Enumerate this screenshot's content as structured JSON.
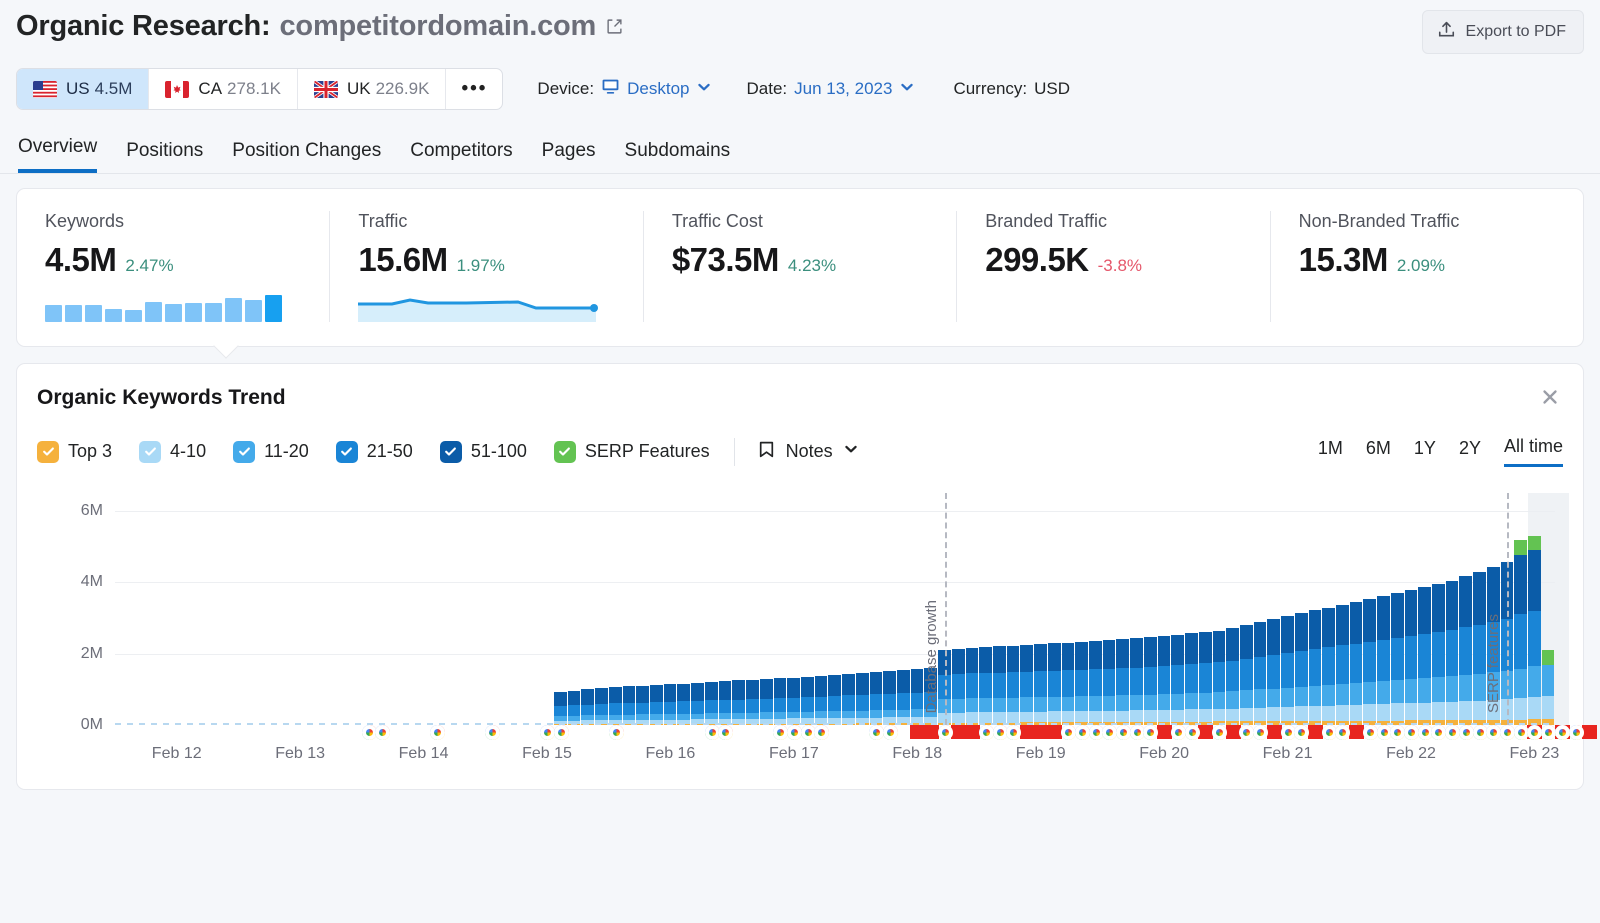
{
  "header": {
    "title_prefix": "Organic Research:",
    "domain": "competitordomain.com",
    "external_link_icon": "external-link-icon",
    "export_label": "Export to PDF",
    "export_icon": "upload-icon"
  },
  "filters": {
    "countries": [
      {
        "code": "US",
        "value": "4.5M",
        "flag": "us-flag-icon",
        "active": true
      },
      {
        "code": "CA",
        "value": "278.1K",
        "flag": "ca-flag-icon",
        "active": false
      },
      {
        "code": "UK",
        "value": "226.9K",
        "flag": "uk-flag-icon",
        "active": false
      }
    ],
    "more_label": "•••",
    "device": {
      "label": "Device:",
      "value": "Desktop",
      "icon": "monitor-icon"
    },
    "date": {
      "label": "Date:",
      "value": "Jun 13, 2023"
    },
    "currency": {
      "label": "Currency:",
      "value": "USD"
    }
  },
  "tabs": [
    {
      "label": "Overview",
      "active": true
    },
    {
      "label": "Positions",
      "active": false
    },
    {
      "label": "Position Changes",
      "active": false
    },
    {
      "label": "Competitors",
      "active": false
    },
    {
      "label": "Pages",
      "active": false
    },
    {
      "label": "Subdomains",
      "active": false
    }
  ],
  "metrics": [
    {
      "label": "Keywords",
      "value": "4.5M",
      "delta": "2.47%",
      "delta_dir": "pos",
      "spark": "bars"
    },
    {
      "label": "Traffic",
      "value": "15.6M",
      "delta": "1.97%",
      "delta_dir": "pos",
      "spark": "area"
    },
    {
      "label": "Traffic Cost",
      "value": "$73.5M",
      "delta": "4.23%",
      "delta_dir": "pos",
      "spark": "none"
    },
    {
      "label": "Branded Traffic",
      "value": "299.5K",
      "delta": "-3.8%",
      "delta_dir": "neg",
      "spark": "none"
    },
    {
      "label": "Non-Branded Traffic",
      "value": "15.3M",
      "delta": "2.09%",
      "delta_dir": "pos",
      "spark": "none"
    }
  ],
  "panel": {
    "title": "Organic Keywords Trend",
    "close_icon": "close-icon",
    "notes_label": "Notes",
    "notes_icon": "note-flag-icon",
    "legend": [
      {
        "label": "Top 3",
        "color": "#f5b13d",
        "checked": true
      },
      {
        "label": "4-10",
        "color": "#a9d9f6",
        "checked": true
      },
      {
        "label": "11-20",
        "color": "#44aaea",
        "checked": true
      },
      {
        "label": "21-50",
        "color": "#1a85d6",
        "checked": true
      },
      {
        "label": "51-100",
        "color": "#0b5ca8",
        "checked": true
      },
      {
        "label": "SERP Features",
        "color": "#63c352",
        "checked": true
      }
    ],
    "ranges": [
      {
        "label": "1M",
        "active": false
      },
      {
        "label": "6M",
        "active": false
      },
      {
        "label": "1Y",
        "active": false
      },
      {
        "label": "2Y",
        "active": false
      },
      {
        "label": "All time",
        "active": true
      }
    ]
  },
  "chart_data": {
    "type": "bar",
    "title": "Organic Keywords Trend",
    "stacked": true,
    "xlabel": "",
    "ylabel": "",
    "ylim": [
      0,
      6500000
    ],
    "yticks": [
      "0M",
      "2M",
      "4M",
      "6M"
    ],
    "ytick_values": [
      0,
      2000000,
      4000000,
      6000000
    ],
    "grid": true,
    "legend_position": "top-left",
    "xtick_labels": [
      "Feb 12",
      "Feb 13",
      "Feb 14",
      "Feb 15",
      "Feb 16",
      "Feb 17",
      "Feb 18",
      "Feb 19",
      "Feb 20",
      "Feb 21",
      "Feb 22",
      "Feb 23"
    ],
    "xtick_positions": [
      4,
      13,
      22,
      31,
      40,
      49,
      58,
      67,
      76,
      85,
      94,
      103
    ],
    "series": [
      {
        "name": "Top 3",
        "color": "#f5b13d",
        "values": [
          0,
          0,
          0,
          0,
          0,
          0,
          0,
          0,
          0,
          0,
          0,
          0,
          0,
          0,
          0,
          0,
          0,
          0,
          0,
          0,
          0,
          0,
          0,
          0,
          0,
          0,
          0,
          0,
          0,
          0,
          0,
          0,
          20000,
          22000,
          23000,
          24000,
          25000,
          26000,
          27000,
          28000,
          29000,
          30000,
          31000,
          32000,
          33000,
          34000,
          35000,
          36000,
          37000,
          38000,
          39000,
          40000,
          41000,
          42000,
          43000,
          44000,
          45000,
          46000,
          47000,
          48000,
          60000,
          62000,
          64000,
          66000,
          68000,
          70000,
          72000,
          74000,
          76000,
          78000,
          80000,
          82000,
          84000,
          86000,
          88000,
          90000,
          92000,
          94000,
          96000,
          98000,
          100000,
          102000,
          104000,
          106000,
          108000,
          110000,
          112000,
          114000,
          116000,
          118000,
          120000,
          122000,
          124000,
          126000,
          128000,
          130000,
          132000,
          134000,
          136000,
          138000,
          140000,
          142000,
          150000,
          160000,
          165000
        ]
      },
      {
        "name": "4-10",
        "color": "#a9d9f6",
        "values": [
          0,
          0,
          0,
          0,
          0,
          0,
          0,
          0,
          0,
          0,
          0,
          0,
          0,
          0,
          0,
          0,
          0,
          0,
          0,
          0,
          0,
          0,
          0,
          0,
          0,
          0,
          0,
          0,
          0,
          0,
          0,
          0,
          90000,
          95000,
          100000,
          105000,
          110000,
          112000,
          115000,
          118000,
          120000,
          122000,
          125000,
          128000,
          130000,
          133000,
          136000,
          140000,
          142000,
          145000,
          148000,
          150000,
          155000,
          158000,
          160000,
          163000,
          166000,
          170000,
          175000,
          180000,
          280000,
          285000,
          290000,
          292000,
          295000,
          297000,
          300000,
          302000,
          305000,
          307000,
          310000,
          312000,
          315000,
          318000,
          320000,
          325000,
          330000,
          335000,
          340000,
          345000,
          350000,
          360000,
          370000,
          380000,
          390000,
          400000,
          410000,
          420000,
          430000,
          440000,
          450000,
          460000,
          470000,
          480000,
          490000,
          500000,
          510000,
          520000,
          530000,
          545000,
          560000,
          575000,
          600000,
          620000,
          640000
        ]
      },
      {
        "name": "11-20",
        "color": "#44aaea",
        "values": [
          0,
          0,
          0,
          0,
          0,
          0,
          0,
          0,
          0,
          0,
          0,
          0,
          0,
          0,
          0,
          0,
          0,
          0,
          0,
          0,
          0,
          0,
          0,
          0,
          0,
          0,
          0,
          0,
          0,
          0,
          0,
          0,
          130000,
          135000,
          140000,
          145000,
          148000,
          150000,
          153000,
          156000,
          158000,
          160000,
          163000,
          166000,
          170000,
          172000,
          175000,
          178000,
          180000,
          183000,
          186000,
          190000,
          195000,
          198000,
          200000,
          205000,
          208000,
          212000,
          216000,
          220000,
          380000,
          385000,
          390000,
          392000,
          395000,
          398000,
          400000,
          403000,
          406000,
          410000,
          413000,
          416000,
          420000,
          424000,
          428000,
          434000,
          440000,
          446000,
          452000,
          458000,
          465000,
          480000,
          495000,
          510000,
          525000,
          540000,
          555000,
          570000,
          585000,
          600000,
          615000,
          630000,
          645000,
          660000,
          675000,
          690000,
          705000,
          720000,
          740000,
          760000,
          780000,
          800000,
          830000,
          860000,
          880000
        ]
      },
      {
        "name": "21-50",
        "color": "#1a85d6",
        "values": [
          0,
          0,
          0,
          0,
          0,
          0,
          0,
          0,
          0,
          0,
          0,
          0,
          0,
          0,
          0,
          0,
          0,
          0,
          0,
          0,
          0,
          0,
          0,
          0,
          0,
          0,
          0,
          0,
          0,
          0,
          0,
          0,
          280000,
          290000,
          300000,
          310000,
          318000,
          325000,
          330000,
          338000,
          344000,
          350000,
          356000,
          362000,
          370000,
          376000,
          382000,
          388000,
          394000,
          400000,
          408000,
          415000,
          422000,
          430000,
          438000,
          446000,
          454000,
          462000,
          470000,
          480000,
          680000,
          690000,
          700000,
          706000,
          712000,
          718000,
          724000,
          730000,
          736000,
          742000,
          748000,
          754000,
          760000,
          768000,
          776000,
          786000,
          796000,
          806000,
          816000,
          828000,
          840000,
          866000,
          892000,
          918000,
          944000,
          970000,
          996000,
          1020000,
          1046000,
          1072000,
          1098000,
          1124000,
          1150000,
          1176000,
          1202000,
          1228000,
          1254000,
          1290000,
          1330000,
          1370000,
          1410000,
          1460000,
          1520000,
          1560000
        ]
      },
      {
        "name": "51-100",
        "color": "#0b5ca8",
        "values": [
          0,
          0,
          0,
          0,
          0,
          0,
          0,
          0,
          0,
          0,
          0,
          0,
          0,
          0,
          0,
          0,
          0,
          0,
          0,
          0,
          0,
          0,
          0,
          0,
          0,
          0,
          0,
          0,
          0,
          0,
          0,
          0,
          400000,
          415000,
          430000,
          445000,
          455000,
          465000,
          474000,
          484000,
          492000,
          500000,
          508000,
          516000,
          526000,
          534000,
          542000,
          550000,
          558000,
          566000,
          576000,
          586000,
          596000,
          606000,
          616000,
          626000,
          636000,
          648000,
          660000,
          674000,
          700000,
          712000,
          724000,
          730000,
          738000,
          744000,
          752000,
          758000,
          766000,
          772000,
          780000,
          788000,
          796000,
          806000,
          816000,
          828000,
          840000,
          852000,
          864000,
          878000,
          892000,
          920000,
          948000,
          976000,
          1004000,
          1032000,
          1060000,
          1086000,
          1114000,
          1142000,
          1170000,
          1198000,
          1226000,
          1254000,
          1282000,
          1310000,
          1338000,
          1380000,
          1430000,
          1480000,
          1530000,
          1590000,
          1660000,
          1700000
        ]
      },
      {
        "name": "SERP Features",
        "color": "#63c352",
        "values": [
          0,
          0,
          0,
          0,
          0,
          0,
          0,
          0,
          0,
          0,
          0,
          0,
          0,
          0,
          0,
          0,
          0,
          0,
          0,
          0,
          0,
          0,
          0,
          0,
          0,
          0,
          0,
          0,
          0,
          0,
          0,
          0,
          0,
          0,
          0,
          0,
          0,
          0,
          0,
          0,
          0,
          0,
          0,
          0,
          0,
          0,
          0,
          0,
          0,
          0,
          0,
          0,
          0,
          0,
          0,
          0,
          0,
          0,
          0,
          0,
          0,
          0,
          0,
          0,
          0,
          0,
          0,
          0,
          0,
          0,
          0,
          0,
          0,
          0,
          0,
          0,
          0,
          0,
          0,
          0,
          0,
          0,
          0,
          0,
          0,
          0,
          0,
          0,
          0,
          0,
          0,
          0,
          0,
          0,
          0,
          0,
          0,
          0,
          0,
          0,
          0,
          0,
          420000,
          400000,
          430000
        ]
      }
    ],
    "annotations": [
      {
        "label": "Database growth",
        "x_index": 60
      },
      {
        "label": "SERP features",
        "x_index": 101
      }
    ],
    "highlight_band": {
      "from_index": 103,
      "to_index": 105
    },
    "markers": {
      "google_update_label": "Google update",
      "flag_label": "SERP volatility",
      "google_indices": [
        18,
        19,
        23,
        27,
        31,
        32,
        36,
        43,
        44,
        48,
        49,
        50,
        51,
        55,
        56,
        60,
        63,
        64,
        65,
        69,
        70,
        71,
        72,
        73,
        74,
        75,
        77,
        78,
        80,
        82,
        83,
        85,
        86,
        88,
        89,
        91,
        92,
        93,
        94,
        95,
        96,
        97,
        98,
        99,
        100,
        101,
        102,
        103,
        104,
        105,
        106
      ],
      "flag_indices": [
        58,
        59,
        61,
        62,
        66,
        67,
        68,
        76,
        79,
        81,
        84,
        87,
        90,
        103,
        105,
        107
      ]
    }
  }
}
